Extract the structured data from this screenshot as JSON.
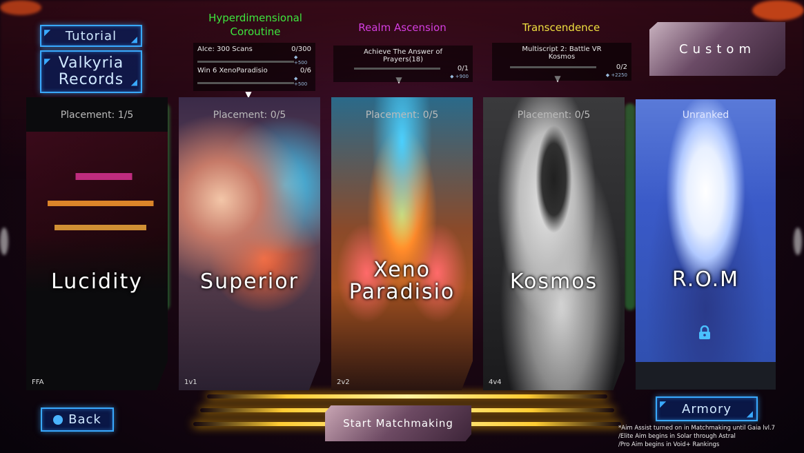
{
  "nav": {
    "tutorial_label": "Tutorial",
    "records_label_line1": "Valkyria",
    "records_label_line2": "Records",
    "custom_label": "Custom",
    "armory_label": "Armory",
    "back_label": "Back",
    "start_label": "Start Matchmaking"
  },
  "challenges": [
    {
      "title_line1": "Hyperdimensional",
      "title_line2": "Coroutine",
      "color": "#3ee63e",
      "tasks": [
        {
          "label": "AIce: 300 Scans",
          "progress_text": "0/300",
          "reward": "+500",
          "progress": 0
        },
        {
          "label": "Win 6 XenoParadisio",
          "progress_text": "0/6",
          "reward": "+500",
          "progress": 0
        }
      ]
    },
    {
      "title_line1": "Realm Ascension",
      "title_line2": "",
      "color": "#d43ee0",
      "tasks": [
        {
          "label": "Achieve The Answer of Prayers(18)",
          "progress_text": "0/1",
          "reward": "+900",
          "progress": 0
        }
      ]
    },
    {
      "title_line1": "Transcendence",
      "title_line2": "",
      "color": "#f0e040",
      "tasks": [
        {
          "label": "Multiscript 2: Battle VR Kosmos",
          "progress_text": "0/2",
          "reward": "+2250",
          "progress": 0
        }
      ]
    }
  ],
  "modes": [
    {
      "name": "Lucidity",
      "placement": "Placement: 1/5",
      "type": "FFA",
      "locked": false
    },
    {
      "name": "Superior",
      "placement": "Placement: 0/5",
      "type": "1v1",
      "locked": false
    },
    {
      "name_line1": "Xeno",
      "name_line2": "Paradisio",
      "placement": "Placement: 0/5",
      "type": "2v2",
      "locked": false
    },
    {
      "name": "Kosmos",
      "placement": "Placement: 0/5",
      "type": "4v4",
      "locked": false
    },
    {
      "name": "R.O.M",
      "placement": "Unranked",
      "type": "",
      "locked": true
    }
  ],
  "footnotes": [
    "*Aim Assist turned on in Matchmaking until Gaia lvl.7",
    "/Elite Aim begins in Solar through Astral",
    "/Pro Aim begins in Void+ Rankings"
  ],
  "icons": {
    "back": "circle-icon",
    "lock": "lock-icon",
    "reward": "gem-icon"
  }
}
